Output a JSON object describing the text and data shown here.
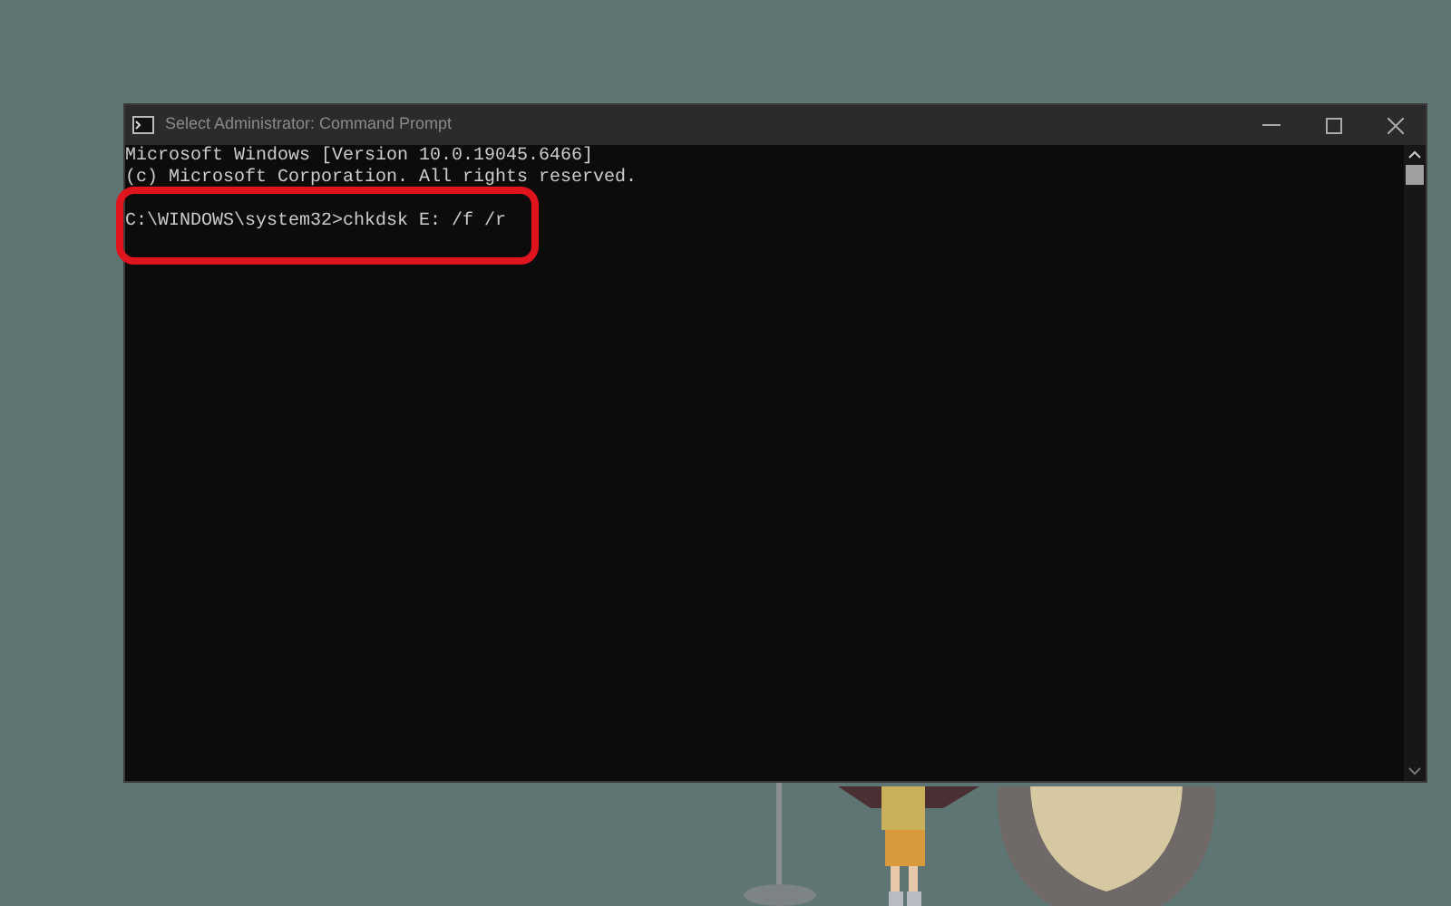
{
  "window": {
    "title": "Select Administrator: Command Prompt"
  },
  "console": {
    "lines": [
      "Microsoft Windows [Version 10.0.19045.6466]",
      "(c) Microsoft Corporation. All rights reserved."
    ],
    "prompt": "C:\\WINDOWS\\system32>chkdsk E: /f /r"
  }
}
